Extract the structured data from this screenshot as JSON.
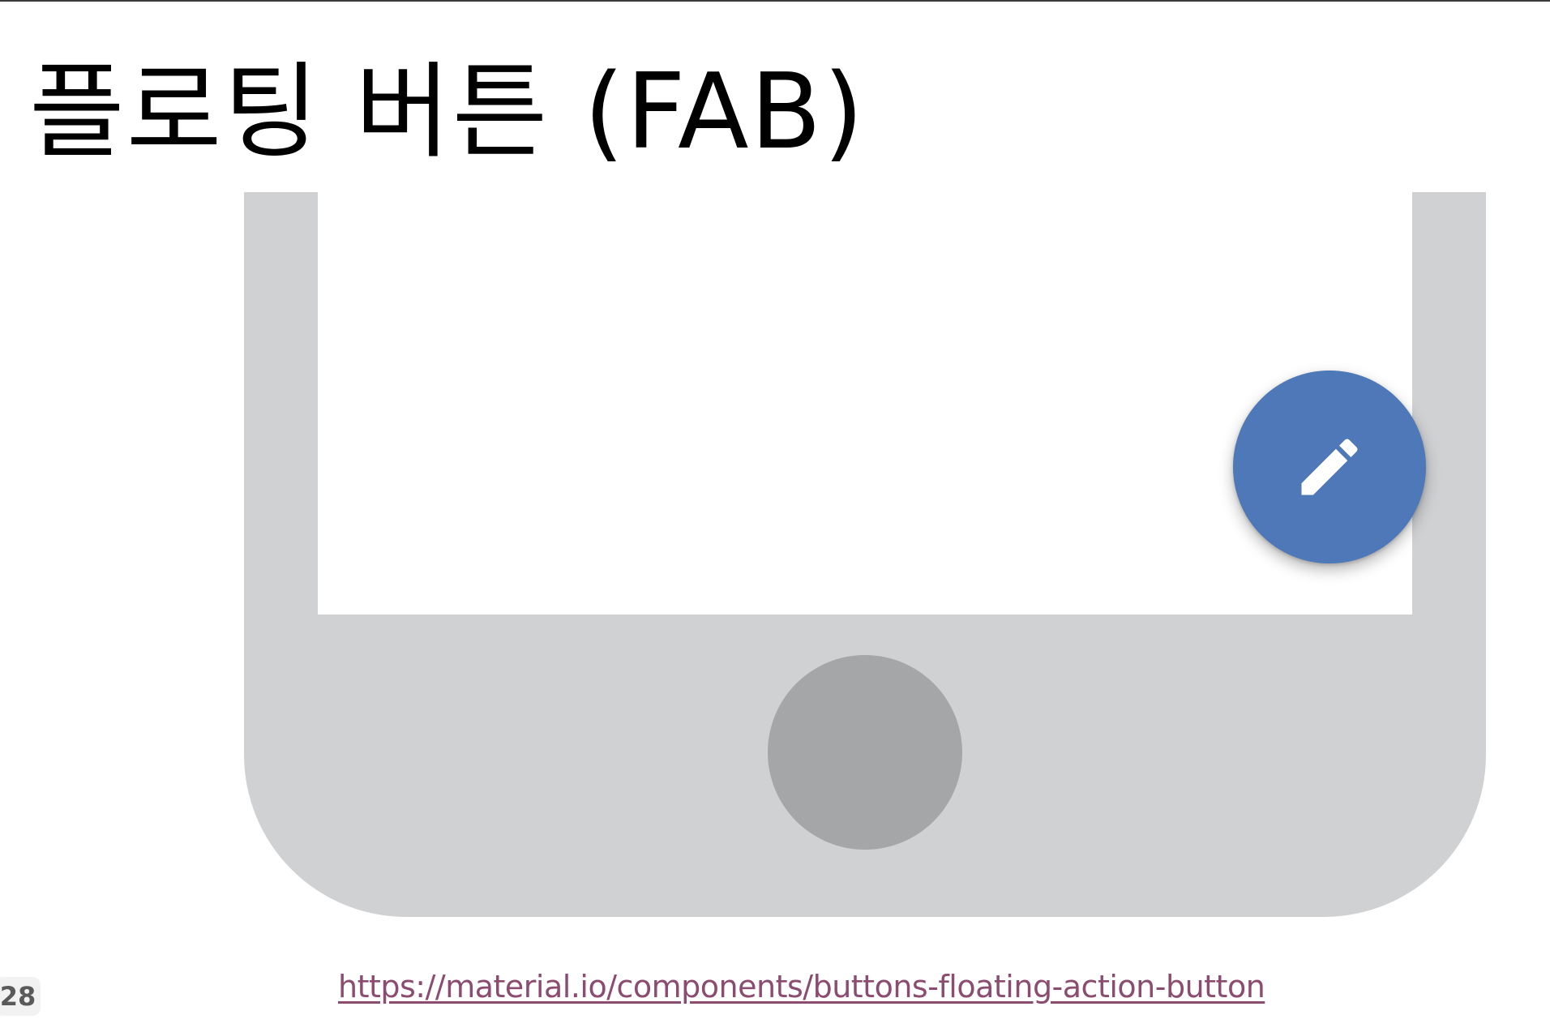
{
  "slide": {
    "title": "플로팅 버튼 (FAB)",
    "page_number": "28"
  },
  "phone": {
    "fab_icon": "pencil-edit-icon",
    "fab_color": "#4e78b8",
    "body_color": "#d0d1d3",
    "home_button_color": "#a5a6a8"
  },
  "source": {
    "link_text": "https://material.io/components/buttons-floating-action-button",
    "link_color": "#8b4c6f"
  }
}
